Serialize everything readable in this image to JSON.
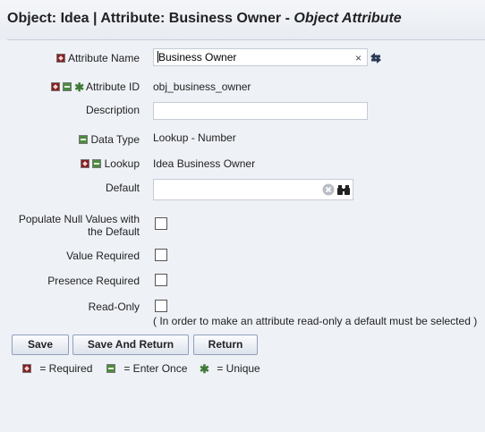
{
  "header": {
    "title_main": "Object: Idea | Attribute: Business Owner - ",
    "title_italic": "Object Attribute"
  },
  "form": {
    "attribute_name_label": "Attribute Name",
    "attribute_name_value": "Business Owner",
    "attribute_id_label": "Attribute ID",
    "attribute_id_value": "obj_business_owner",
    "description_label": "Description",
    "description_value": "",
    "data_type_label": "Data Type",
    "data_type_value": "Lookup - Number",
    "lookup_label": "Lookup",
    "lookup_value": "Idea Business Owner",
    "default_label": "Default",
    "default_value": "",
    "populate_null_label_1": "Populate Null Values with",
    "populate_null_label_2": "the Default",
    "populate_null_checked": false,
    "value_required_label": "Value Required",
    "value_required_checked": false,
    "presence_required_label": "Presence Required",
    "presence_required_checked": false,
    "read_only_label": "Read-Only",
    "read_only_checked": false,
    "read_only_hint": "( In order to make an attribute read-only a default must be selected )"
  },
  "buttons": {
    "save": "Save",
    "save_and_return": "Save And Return",
    "return": "Return"
  },
  "legend": {
    "required": "= Required",
    "enter_once": "= Enter Once",
    "unique": "= Unique"
  },
  "icons": {
    "required": "required-icon",
    "enter_once": "enter-once-icon",
    "unique": "unique-icon",
    "clear": "clear-icon",
    "swap": "swap-icon",
    "lookup": "binoculars-icon"
  },
  "colors": {
    "required": "#8a1d1d",
    "enter_once": "#4b8c3c",
    "unique": "#3e7a35",
    "background": "#eef1f6"
  }
}
